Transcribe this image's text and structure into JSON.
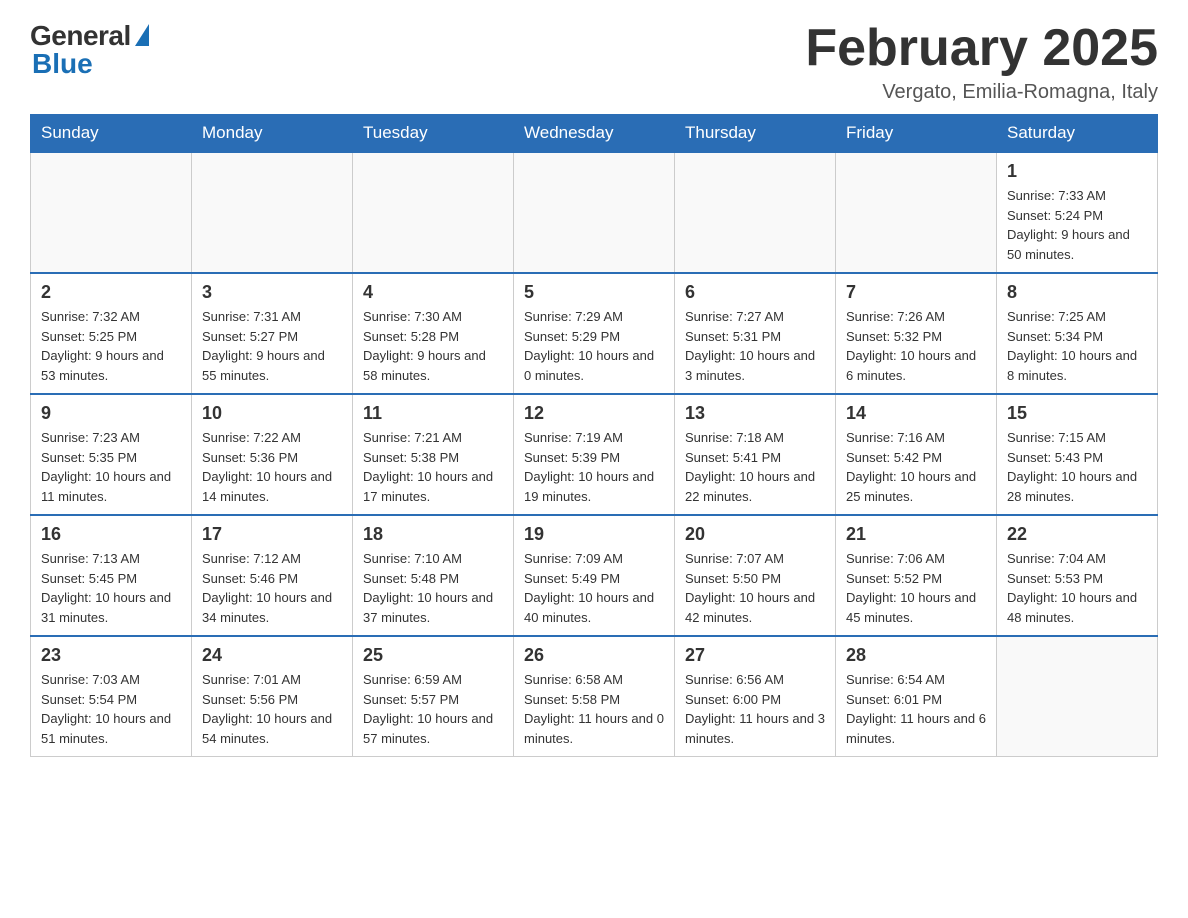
{
  "header": {
    "logo": {
      "general": "General",
      "blue": "Blue"
    },
    "title": "February 2025",
    "location": "Vergato, Emilia-Romagna, Italy"
  },
  "weekdays": [
    "Sunday",
    "Monday",
    "Tuesday",
    "Wednesday",
    "Thursday",
    "Friday",
    "Saturday"
  ],
  "weeks": [
    [
      {
        "day": "",
        "info": ""
      },
      {
        "day": "",
        "info": ""
      },
      {
        "day": "",
        "info": ""
      },
      {
        "day": "",
        "info": ""
      },
      {
        "day": "",
        "info": ""
      },
      {
        "day": "",
        "info": ""
      },
      {
        "day": "1",
        "info": "Sunrise: 7:33 AM\nSunset: 5:24 PM\nDaylight: 9 hours and 50 minutes."
      }
    ],
    [
      {
        "day": "2",
        "info": "Sunrise: 7:32 AM\nSunset: 5:25 PM\nDaylight: 9 hours and 53 minutes."
      },
      {
        "day": "3",
        "info": "Sunrise: 7:31 AM\nSunset: 5:27 PM\nDaylight: 9 hours and 55 minutes."
      },
      {
        "day": "4",
        "info": "Sunrise: 7:30 AM\nSunset: 5:28 PM\nDaylight: 9 hours and 58 minutes."
      },
      {
        "day": "5",
        "info": "Sunrise: 7:29 AM\nSunset: 5:29 PM\nDaylight: 10 hours and 0 minutes."
      },
      {
        "day": "6",
        "info": "Sunrise: 7:27 AM\nSunset: 5:31 PM\nDaylight: 10 hours and 3 minutes."
      },
      {
        "day": "7",
        "info": "Sunrise: 7:26 AM\nSunset: 5:32 PM\nDaylight: 10 hours and 6 minutes."
      },
      {
        "day": "8",
        "info": "Sunrise: 7:25 AM\nSunset: 5:34 PM\nDaylight: 10 hours and 8 minutes."
      }
    ],
    [
      {
        "day": "9",
        "info": "Sunrise: 7:23 AM\nSunset: 5:35 PM\nDaylight: 10 hours and 11 minutes."
      },
      {
        "day": "10",
        "info": "Sunrise: 7:22 AM\nSunset: 5:36 PM\nDaylight: 10 hours and 14 minutes."
      },
      {
        "day": "11",
        "info": "Sunrise: 7:21 AM\nSunset: 5:38 PM\nDaylight: 10 hours and 17 minutes."
      },
      {
        "day": "12",
        "info": "Sunrise: 7:19 AM\nSunset: 5:39 PM\nDaylight: 10 hours and 19 minutes."
      },
      {
        "day": "13",
        "info": "Sunrise: 7:18 AM\nSunset: 5:41 PM\nDaylight: 10 hours and 22 minutes."
      },
      {
        "day": "14",
        "info": "Sunrise: 7:16 AM\nSunset: 5:42 PM\nDaylight: 10 hours and 25 minutes."
      },
      {
        "day": "15",
        "info": "Sunrise: 7:15 AM\nSunset: 5:43 PM\nDaylight: 10 hours and 28 minutes."
      }
    ],
    [
      {
        "day": "16",
        "info": "Sunrise: 7:13 AM\nSunset: 5:45 PM\nDaylight: 10 hours and 31 minutes."
      },
      {
        "day": "17",
        "info": "Sunrise: 7:12 AM\nSunset: 5:46 PM\nDaylight: 10 hours and 34 minutes."
      },
      {
        "day": "18",
        "info": "Sunrise: 7:10 AM\nSunset: 5:48 PM\nDaylight: 10 hours and 37 minutes."
      },
      {
        "day": "19",
        "info": "Sunrise: 7:09 AM\nSunset: 5:49 PM\nDaylight: 10 hours and 40 minutes."
      },
      {
        "day": "20",
        "info": "Sunrise: 7:07 AM\nSunset: 5:50 PM\nDaylight: 10 hours and 42 minutes."
      },
      {
        "day": "21",
        "info": "Sunrise: 7:06 AM\nSunset: 5:52 PM\nDaylight: 10 hours and 45 minutes."
      },
      {
        "day": "22",
        "info": "Sunrise: 7:04 AM\nSunset: 5:53 PM\nDaylight: 10 hours and 48 minutes."
      }
    ],
    [
      {
        "day": "23",
        "info": "Sunrise: 7:03 AM\nSunset: 5:54 PM\nDaylight: 10 hours and 51 minutes."
      },
      {
        "day": "24",
        "info": "Sunrise: 7:01 AM\nSunset: 5:56 PM\nDaylight: 10 hours and 54 minutes."
      },
      {
        "day": "25",
        "info": "Sunrise: 6:59 AM\nSunset: 5:57 PM\nDaylight: 10 hours and 57 minutes."
      },
      {
        "day": "26",
        "info": "Sunrise: 6:58 AM\nSunset: 5:58 PM\nDaylight: 11 hours and 0 minutes."
      },
      {
        "day": "27",
        "info": "Sunrise: 6:56 AM\nSunset: 6:00 PM\nDaylight: 11 hours and 3 minutes."
      },
      {
        "day": "28",
        "info": "Sunrise: 6:54 AM\nSunset: 6:01 PM\nDaylight: 11 hours and 6 minutes."
      },
      {
        "day": "",
        "info": ""
      }
    ]
  ]
}
